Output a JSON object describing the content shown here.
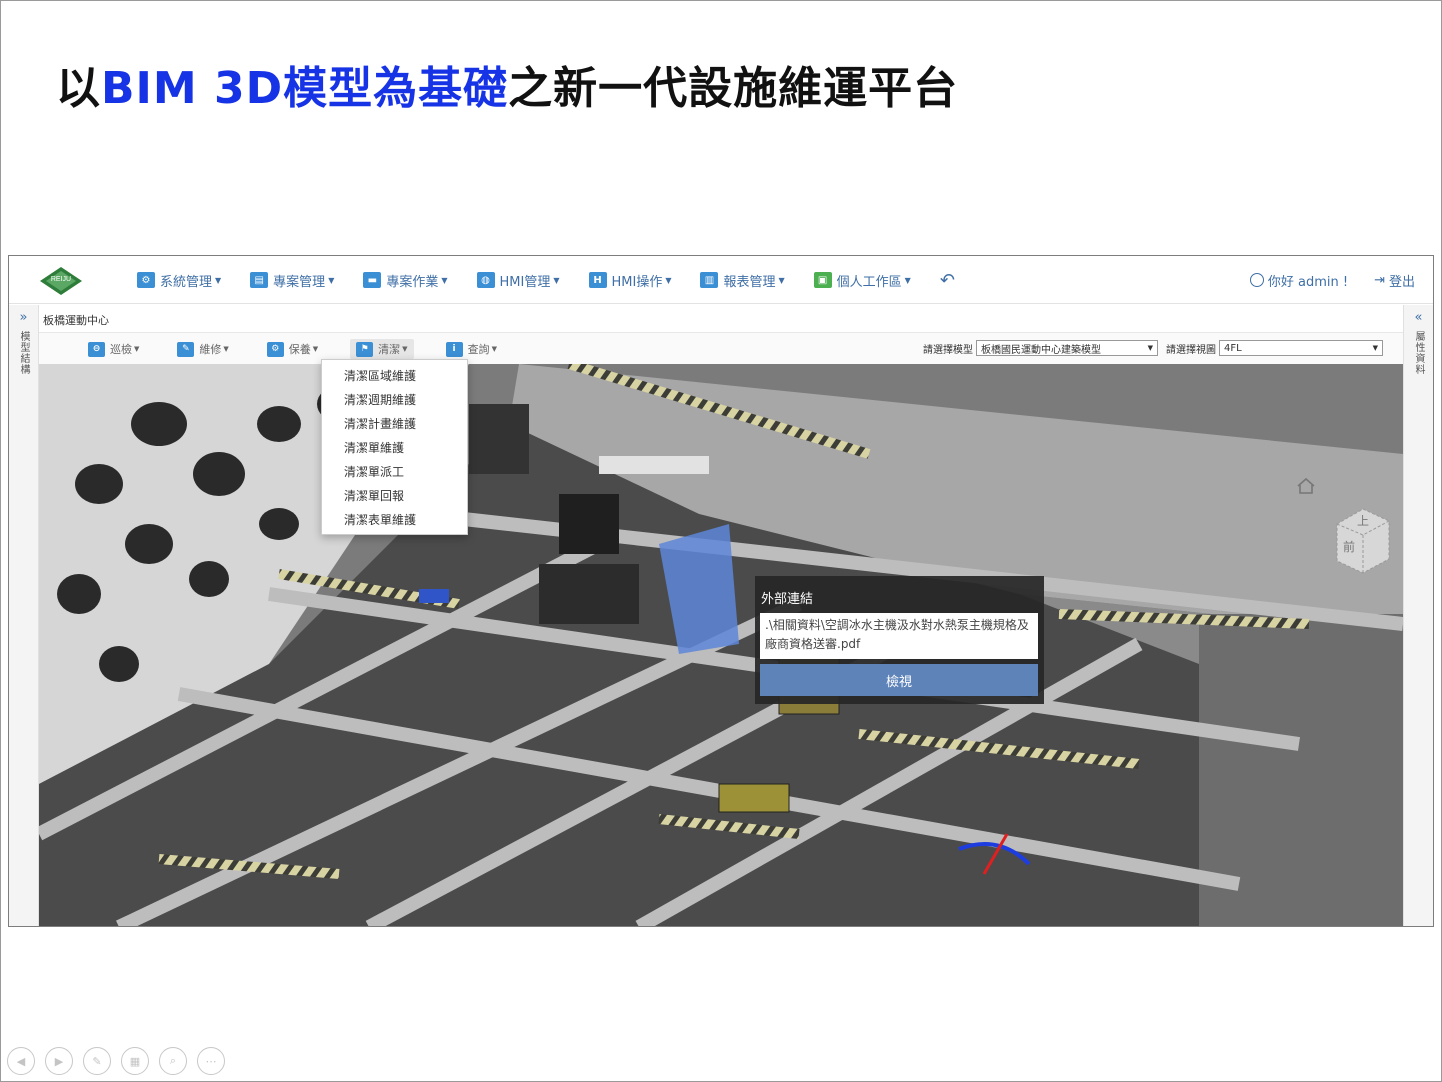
{
  "slide": {
    "title_part1": "以",
    "title_highlight": "BIM 3D模型為基礎",
    "title_part2": "之新一代設施維運平台",
    "highlight_color": "#1733e6"
  },
  "navbar": {
    "logo_text": "REIJU",
    "items": [
      {
        "label": "系統管理",
        "icon": "gear-icon"
      },
      {
        "label": "專案管理",
        "icon": "document-icon"
      },
      {
        "label": "專案作業",
        "icon": "briefcase-icon"
      },
      {
        "label": "HMI管理",
        "icon": "globe-icon"
      },
      {
        "label": "HMI操作",
        "icon": "h-icon"
      },
      {
        "label": "報表管理",
        "icon": "chart-icon"
      },
      {
        "label": "個人工作區",
        "icon": "lock-icon"
      }
    ],
    "back_icon": "undo-icon",
    "user_greeting": "你好 admin !",
    "logout_label": "登出",
    "accent_color": "#3f6fa6"
  },
  "left_rail": {
    "chevron": "»",
    "label": "模型結構"
  },
  "right_rail": {
    "chevron": "«",
    "label": "屬性資料"
  },
  "breadcrumb": "板橋運動中心",
  "toolbar": {
    "items": [
      {
        "label": "巡檢",
        "icon": "minus-circle-icon"
      },
      {
        "label": "維修",
        "icon": "wrench-icon"
      },
      {
        "label": "保養",
        "icon": "gear-icon"
      },
      {
        "label": "清潔",
        "icon": "flag-icon",
        "active": true
      },
      {
        "label": "查詢",
        "icon": "info-icon"
      }
    ],
    "model_label": "請選擇模型",
    "model_value": "板橋國民運動中心建築模型",
    "view_label": "請選擇視圖",
    "view_value": "4FL"
  },
  "dropdown": {
    "items": [
      "清潔區域維護",
      "清潔週期維護",
      "清潔計畫維護",
      "清潔單維護",
      "清潔單派工",
      "清潔單回報",
      "清潔表單維護"
    ]
  },
  "popup": {
    "title": "外部連結",
    "link_text": ".\\相關資料\\空調冰水主機汲水對水熱泵主機規格及廠商資格送審.pdf",
    "button_label": "檢視",
    "button_color": "#5d83b9"
  },
  "viewcube": {
    "top_label": "上",
    "front_label": "前"
  },
  "viewer_toolbar": {
    "tools": [
      "orbit-icon",
      "pan-icon",
      "zoom-vertical-icon",
      "walk-icon",
      "camera-icon",
      "section-icon",
      "measure-icon",
      "explode-icon",
      "search-icon",
      "model-browser-icon",
      "properties-icon",
      "settings-icon",
      "fullscreen-icon",
      "link-icon"
    ]
  },
  "presentation_controls": [
    "prev-icon",
    "next-icon",
    "pen-icon",
    "slides-icon",
    "zoom-icon",
    "more-icon"
  ]
}
